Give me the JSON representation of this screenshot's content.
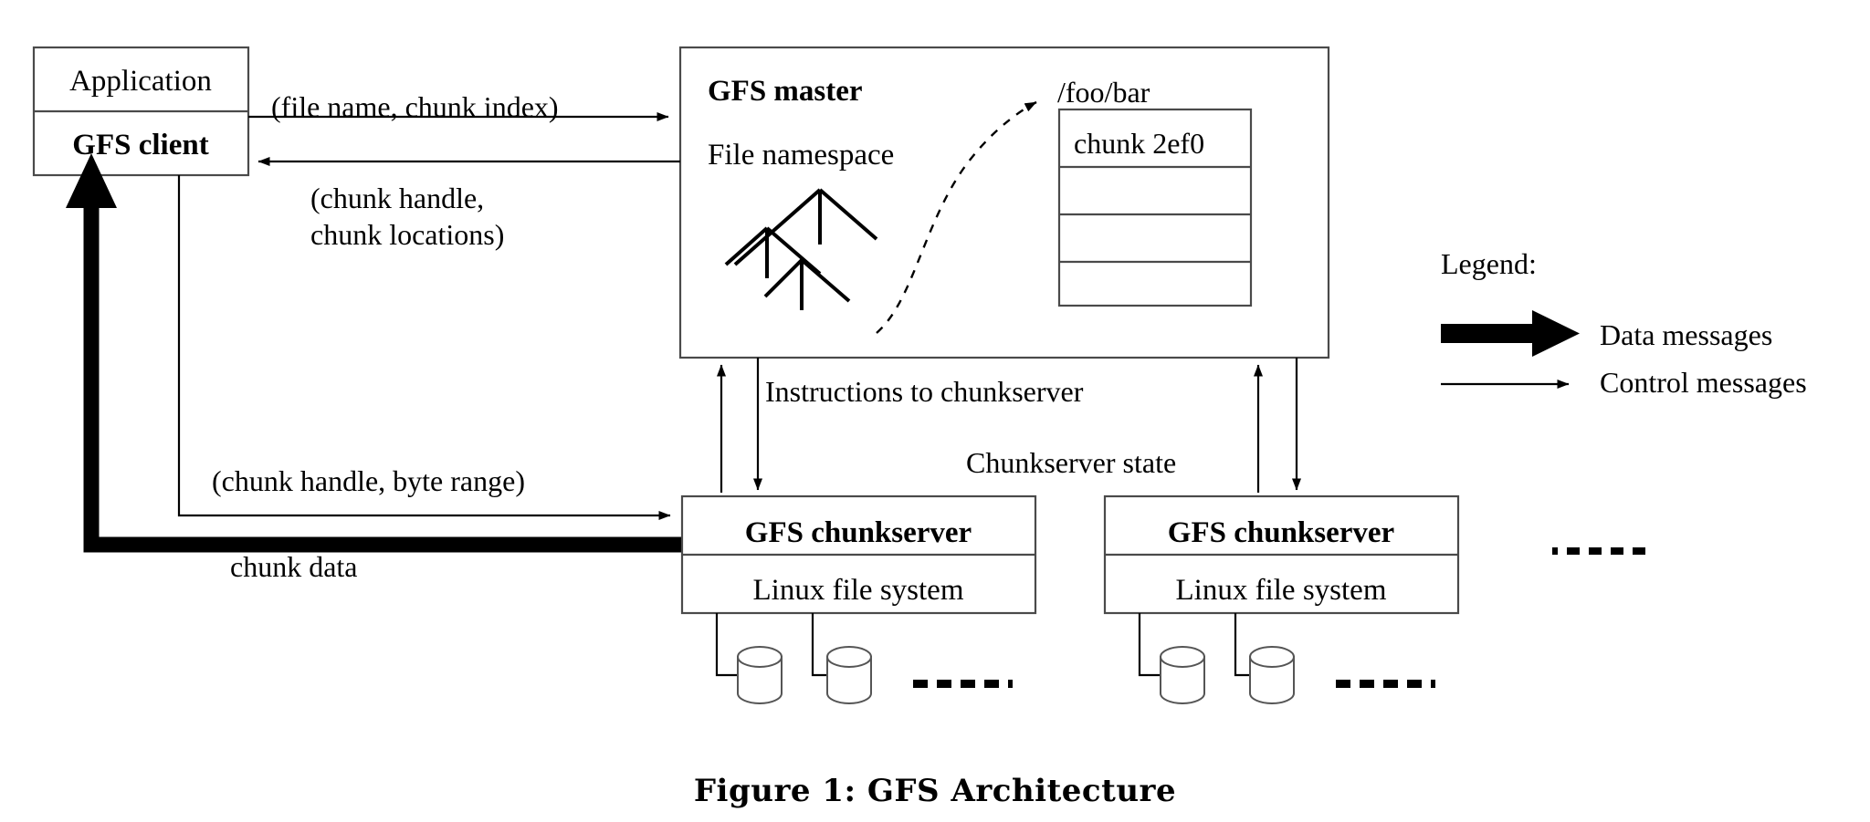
{
  "figure": {
    "caption": "Figure 1:  GFS Architecture",
    "title": "GFS Architecture"
  },
  "nodes": {
    "application": {
      "label": "Application"
    },
    "gfs_client": {
      "label": "GFS client"
    },
    "gfs_master": {
      "title": "GFS master",
      "subtitle": "File namespace",
      "file_path": "/foo/bar",
      "chunk_table": [
        "chunk 2ef0",
        "",
        "",
        ""
      ]
    },
    "chunkserver_1": {
      "title": "GFS chunkserver",
      "subtitle": "Linux file system",
      "disks": 2,
      "more": "....."
    },
    "chunkserver_2": {
      "title": "GFS chunkserver",
      "subtitle": "Linux file system",
      "disks": 2,
      "more": "....."
    },
    "more_chunkservers": {
      "label": "....."
    }
  },
  "edges": {
    "client_to_master": {
      "label": "(file name, chunk index)"
    },
    "master_to_client_l1": {
      "label": "(chunk handle,"
    },
    "master_to_client_l2": {
      "label": "chunk locations)"
    },
    "client_to_chunkserver": {
      "label": "(chunk handle, byte range)"
    },
    "chunkserver_to_client": {
      "label": "chunk data"
    },
    "master_to_chunkserver": {
      "label": "Instructions to chunkserver"
    },
    "chunkserver_to_master": {
      "label": "Chunkserver state"
    }
  },
  "legend": {
    "title": "Legend:",
    "items": [
      {
        "kind": "thick-arrow",
        "label": "Data messages"
      },
      {
        "kind": "thin-arrow",
        "label": "Control messages"
      }
    ]
  },
  "colors": {
    "background": "#ffffff",
    "ink": "#000000",
    "box_stroke": "#4a4a4a"
  }
}
